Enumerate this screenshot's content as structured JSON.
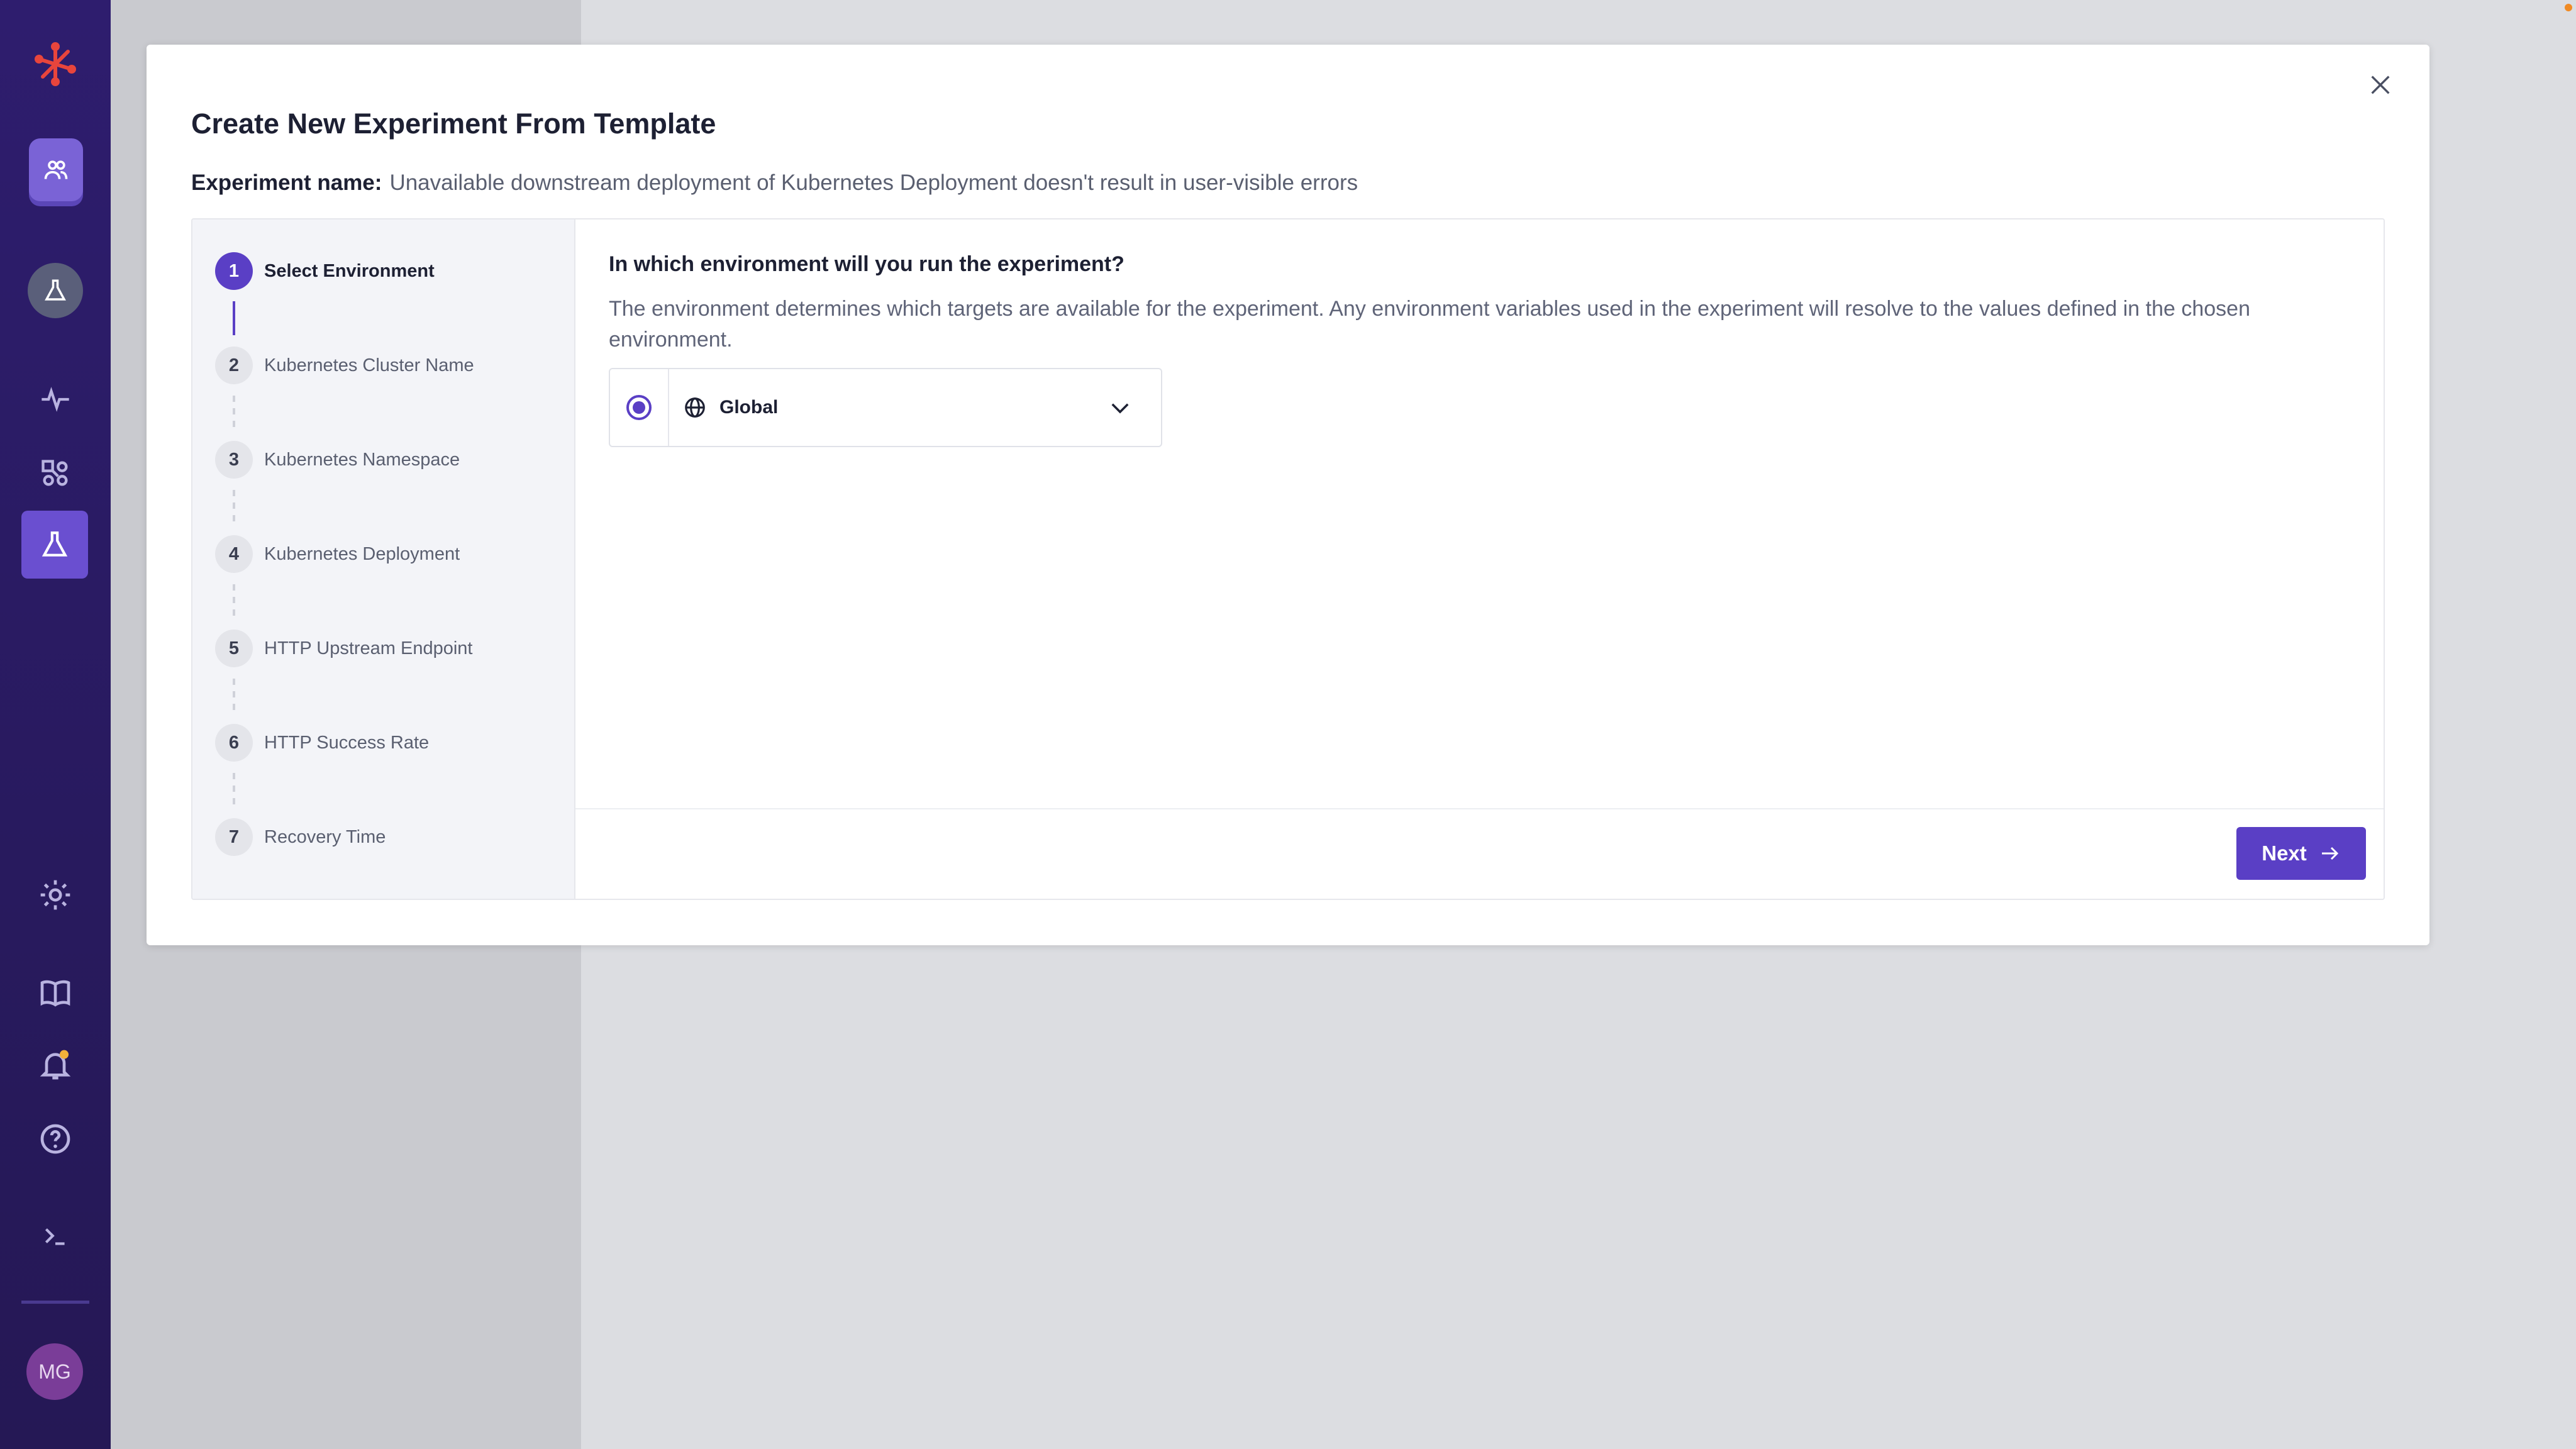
{
  "nav": {
    "items": [
      "logo-icon",
      "team-icon",
      "lab-icon",
      "pulse-icon",
      "nodes-icon",
      "experiments-icon",
      "gear-icon",
      "book-icon",
      "bell-icon",
      "help-icon",
      "terminal-icon"
    ],
    "avatar_initials": "MG",
    "accent": "#5a3fc5",
    "rail_bg": "#2e1d6e"
  },
  "modal": {
    "title": "Create New Experiment From Template",
    "experiment_name_label": "Experiment name:",
    "experiment_name_value": "Unavailable downstream deployment of Kubernetes Deployment doesn't result in user-visible errors",
    "close_icon": "close-icon"
  },
  "steps": [
    {
      "num": "1",
      "label": "Select Environment",
      "active": true
    },
    {
      "num": "2",
      "label": "Kubernetes Cluster Name",
      "active": false
    },
    {
      "num": "3",
      "label": "Kubernetes Namespace",
      "active": false
    },
    {
      "num": "4",
      "label": "Kubernetes Deployment",
      "active": false
    },
    {
      "num": "5",
      "label": "HTTP Upstream Endpoint",
      "active": false
    },
    {
      "num": "6",
      "label": "HTTP Success Rate",
      "active": false
    },
    {
      "num": "7",
      "label": "Recovery Time",
      "active": false
    }
  ],
  "content": {
    "question": "In which environment will you run the experiment?",
    "description": "The environment determines which targets are available for the experiment. Any environment variables used in the experiment will resolve to the values defined in the chosen environment.",
    "environment": {
      "selected": "Global",
      "icon": "globe-icon"
    },
    "next_label": "Next"
  }
}
